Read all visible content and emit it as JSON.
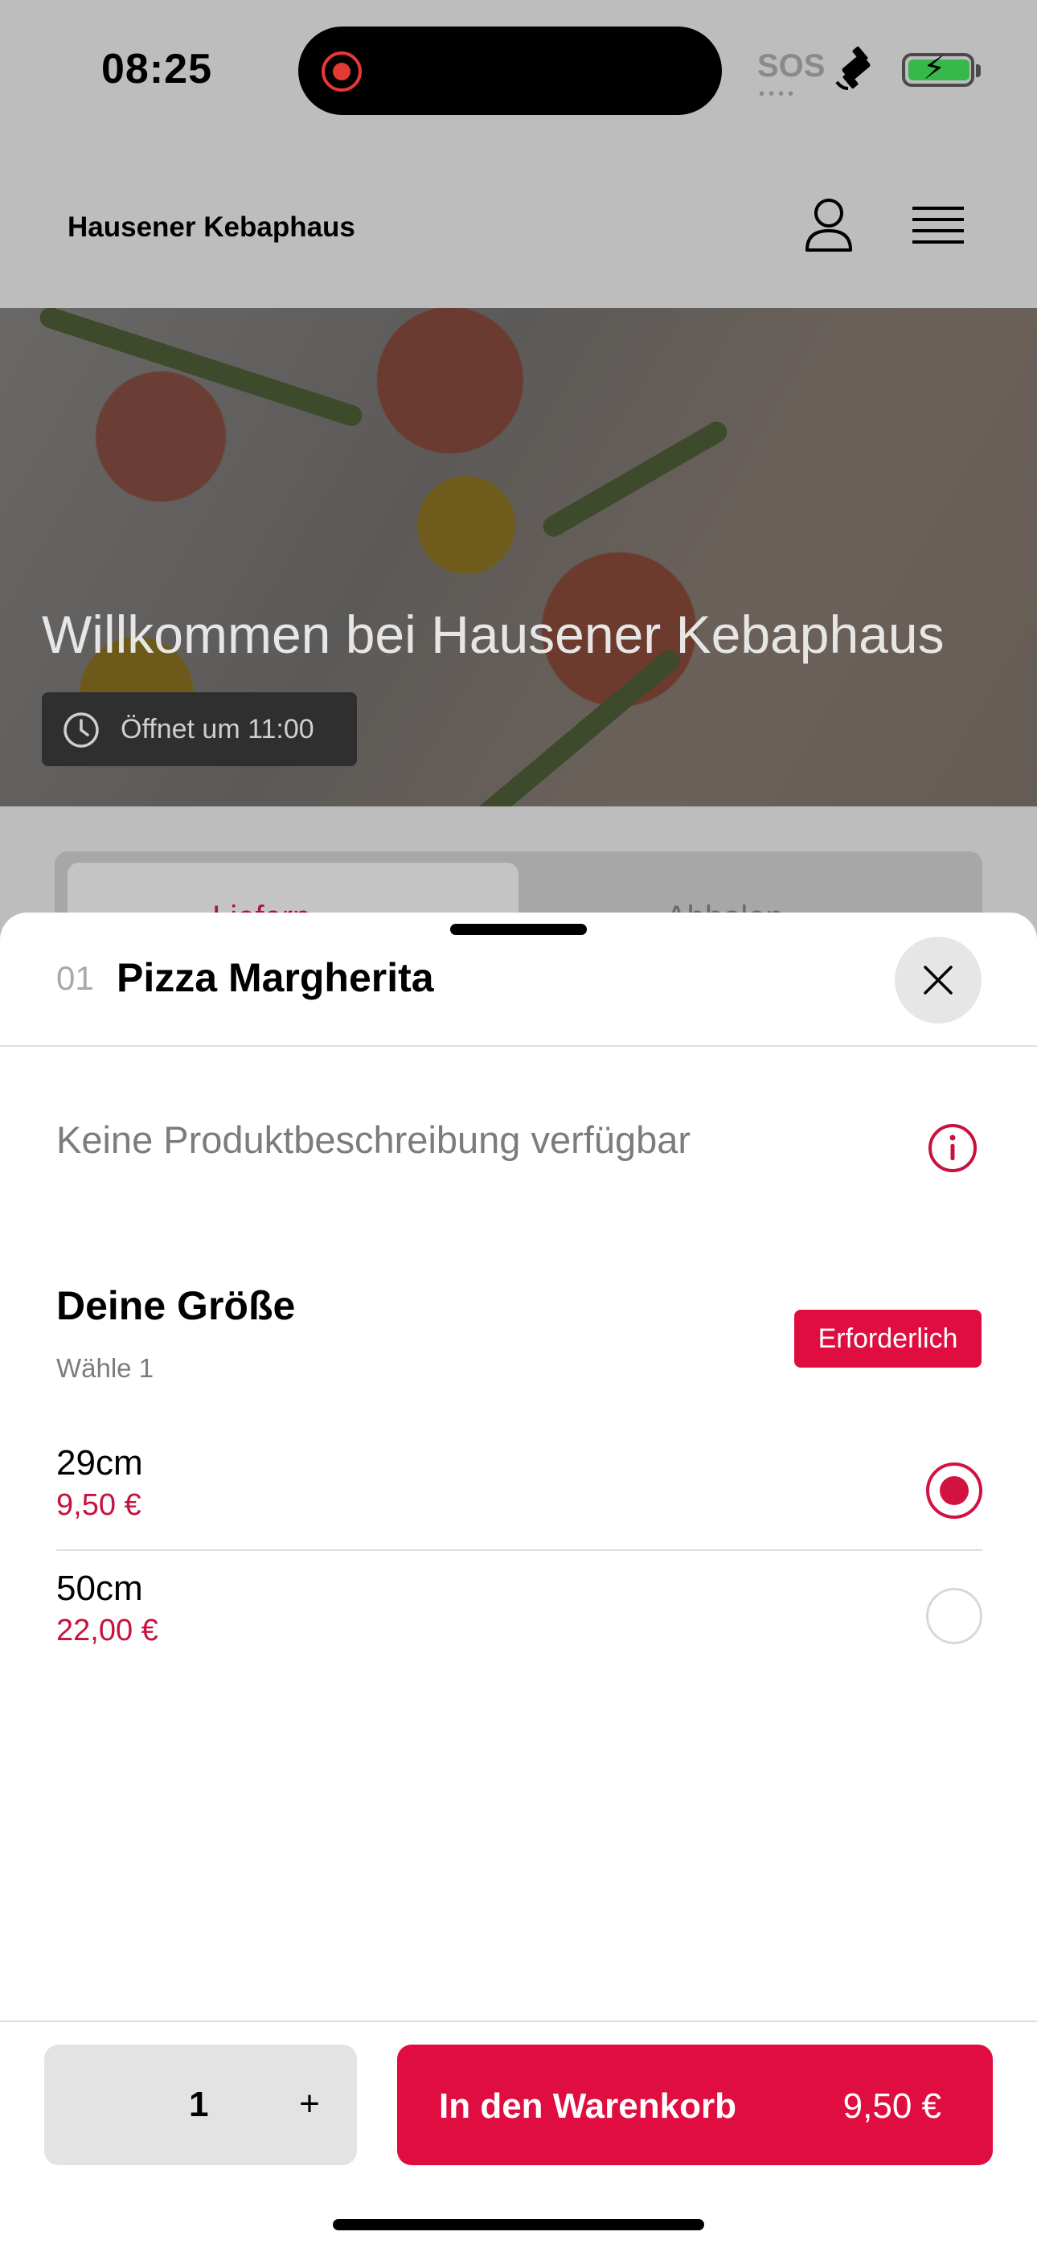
{
  "status_bar": {
    "time": "08:25",
    "sos": "SOS",
    "sos_dots": "••••"
  },
  "header": {
    "shop_name": "Hausener Kebaphaus"
  },
  "hero": {
    "title": "Willkommen bei Hausener Kebaphaus",
    "hours": "Öffnet um 11:00"
  },
  "tabs": [
    {
      "label": "Liefern"
    },
    {
      "label": "Abholen"
    }
  ],
  "sheet": {
    "item_number": "01",
    "item_title": "Pizza Margherita",
    "description": "Keine Produktbeschreibung verfügbar",
    "group": {
      "title": "Deine Größe",
      "subtitle": "Wähle 1",
      "badge": "Erforderlich",
      "options": [
        {
          "name": "29cm",
          "price": "9,50 €",
          "selected": true
        },
        {
          "name": "50cm",
          "price": "22,00 €",
          "selected": false
        }
      ]
    }
  },
  "footer": {
    "quantity": "1",
    "plus": "+",
    "cart_label": "In den Warenkorb",
    "cart_price": "9,50 €"
  },
  "colors": {
    "accent": "#e00d40",
    "price": "#c8123e",
    "overlay_bg": "#bdbdbd"
  },
  "icons": [
    "user-icon",
    "menu-icon",
    "clock-icon",
    "close-icon",
    "info-icon",
    "satellite-icon",
    "battery-icon"
  ]
}
